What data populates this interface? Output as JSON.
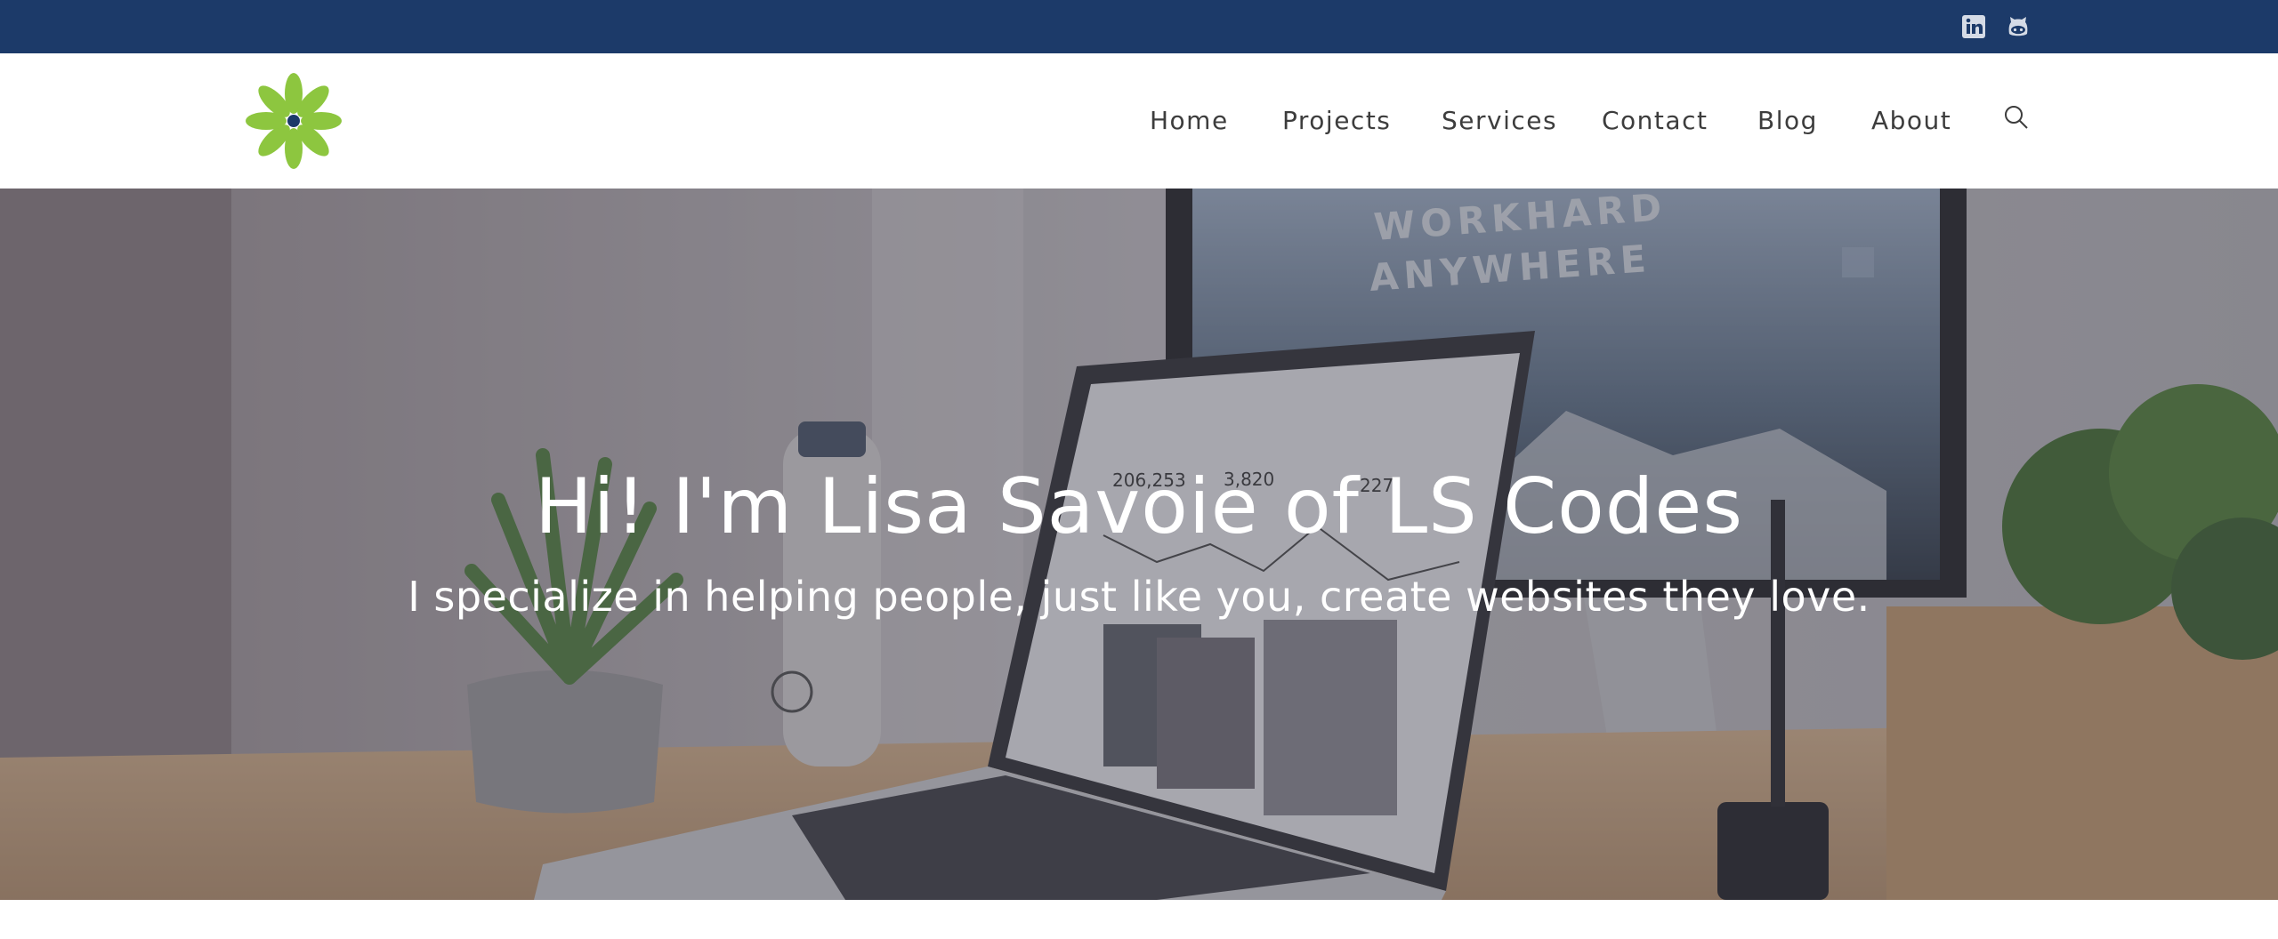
{
  "colors": {
    "topbar_bg": "#1c3a69",
    "logo_petal": "#8dc63f",
    "logo_center": "#1c3a69",
    "nav_text": "#3d3d3d",
    "hero_text": "#ffffff"
  },
  "topbar": {
    "social_icons": [
      {
        "name": "linkedin-icon"
      },
      {
        "name": "github-icon"
      }
    ]
  },
  "header": {
    "logo": {
      "icon": "flower-logo"
    },
    "nav": [
      {
        "label": "Home"
      },
      {
        "label": "Projects"
      },
      {
        "label": "Services"
      },
      {
        "label": "Contact"
      },
      {
        "label": "Blog"
      },
      {
        "label": "About"
      }
    ],
    "search_icon": "search-icon"
  },
  "hero": {
    "title": "Hi! I'm Lisa Savoie of LS Codes",
    "subtitle": "I specialize in helping people, just like you, create websites they love.",
    "background": {
      "monitor_text_line1": "WORKHARD",
      "monitor_text_line2": "ANYWHERE",
      "laptop_stats": [
        "206,253",
        "3,820",
        "227"
      ]
    }
  }
}
